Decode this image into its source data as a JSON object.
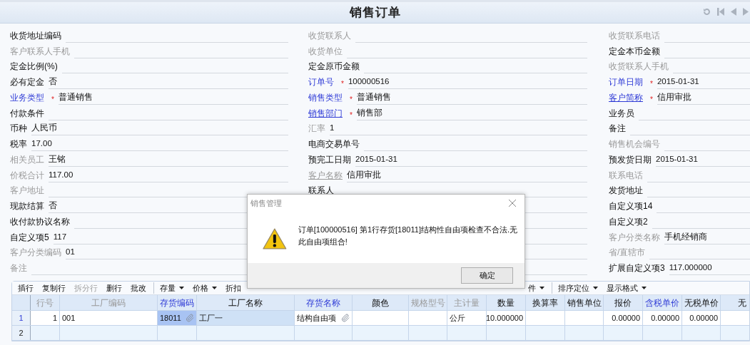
{
  "header": {
    "title": "销售订单"
  },
  "form": {
    "columns": [
      {
        "fields": [
          {
            "label": "收货地址编码",
            "kind": "normal"
          },
          {
            "label": "客户联系人手机",
            "kind": "muted"
          },
          {
            "label": "定金比例(%)",
            "kind": "normal"
          },
          {
            "label": "必有定金",
            "kind": "normal",
            "value": "否"
          },
          {
            "label": "业务类型",
            "kind": "blue",
            "marker": "*",
            "value": "普通销售"
          },
          {
            "label": "付款条件",
            "kind": "normal"
          },
          {
            "label": "币种",
            "kind": "normal",
            "value": "人民币"
          },
          {
            "label": "税率",
            "kind": "normal",
            "value": "17.00"
          },
          {
            "label": "相关员工",
            "kind": "muted",
            "value": "王铭"
          },
          {
            "label": "价税合计",
            "kind": "muted",
            "value": "117.00"
          },
          {
            "label": "客户地址",
            "kind": "muted"
          },
          {
            "label": "现款结算",
            "kind": "normal",
            "value": "否"
          },
          {
            "label": "收付款协议名称",
            "kind": "normal"
          },
          {
            "label": "自定义项5",
            "kind": "normal",
            "value": "117"
          },
          {
            "label": "客户分类编码",
            "kind": "muted",
            "value": "01"
          },
          {
            "label": "备注",
            "kind": "muted"
          }
        ]
      },
      {
        "fields": [
          {
            "label": "收货联系人",
            "kind": "muted"
          },
          {
            "label": "收货单位",
            "kind": "muted"
          },
          {
            "label": "定金原币金额",
            "kind": "normal"
          },
          {
            "label": "订单号",
            "kind": "blue",
            "marker": "*",
            "value": "100000516"
          },
          {
            "label": "销售类型",
            "kind": "blue",
            "marker": "*",
            "value": "普通销售"
          },
          {
            "label": "销售部门",
            "kind": "link",
            "marker": "*",
            "value": "销售部"
          },
          {
            "label": "汇率",
            "kind": "muted",
            "value": "1"
          },
          {
            "label": "电商交易单号",
            "kind": "normal"
          },
          {
            "label": "预完工日期",
            "kind": "normal",
            "value": "2015-01-31"
          },
          {
            "label": "客户名称",
            "kind": "muted_link",
            "value": "信用审批"
          },
          {
            "label": "联系人",
            "kind": "normal"
          }
        ]
      },
      {
        "fields": [
          {
            "label": "收货联系电话",
            "kind": "muted"
          },
          {
            "label": "定金本币金额",
            "kind": "normal"
          },
          {
            "label": "收货联系人手机",
            "kind": "muted"
          },
          {
            "label": "订单日期",
            "kind": "blue",
            "marker": "*",
            "value": "2015-01-31"
          },
          {
            "label": "客户简称",
            "kind": "link",
            "marker": "*",
            "value": "信用审批"
          },
          {
            "label": "业务员",
            "kind": "normal"
          },
          {
            "label": "备注",
            "kind": "normal"
          },
          {
            "label": "销售机会编号",
            "kind": "muted"
          },
          {
            "label": "预发货日期",
            "kind": "normal",
            "value": "2015-01-31"
          },
          {
            "label": "联系电话",
            "kind": "muted"
          },
          {
            "label": "发货地址",
            "kind": "normal"
          },
          {
            "label": "自定义项14",
            "kind": "normal"
          },
          {
            "label": "自定义项2",
            "kind": "normal"
          },
          {
            "label": "客户分类名称",
            "kind": "muted",
            "value": "手机经销商"
          },
          {
            "label": "省/直辖市",
            "kind": "muted"
          },
          {
            "label": "扩展自定义项3",
            "kind": "normal",
            "value": "117.000000"
          }
        ]
      }
    ]
  },
  "grid": {
    "toolbar": [
      {
        "label": "插行",
        "disabled": false,
        "dropdown": false,
        "separator_before": false
      },
      {
        "label": "复制行",
        "disabled": false,
        "dropdown": false,
        "separator_before": false
      },
      {
        "label": "拆分行",
        "disabled": true,
        "dropdown": false,
        "separator_before": false
      },
      {
        "label": "删行",
        "disabled": false,
        "dropdown": false,
        "separator_before": false
      },
      {
        "label": "批改",
        "disabled": false,
        "dropdown": false,
        "separator_before": false
      },
      {
        "label": "存量",
        "disabled": false,
        "dropdown": true,
        "separator_before": true
      },
      {
        "label": "价格",
        "disabled": false,
        "dropdown": true,
        "separator_before": false
      },
      {
        "label": "折扣",
        "disabled": false,
        "dropdown": false,
        "separator_before": false
      },
      {
        "label": "件",
        "disabled": false,
        "dropdown": true,
        "separator_before": false
      },
      {
        "label": "排序定位",
        "disabled": false,
        "dropdown": true,
        "separator_before": true
      },
      {
        "label": "显示格式",
        "disabled": false,
        "dropdown": true,
        "separator_before": false
      }
    ],
    "columns": [
      {
        "label": "行号",
        "kind": "muted"
      },
      {
        "label": "工厂编码",
        "kind": "muted"
      },
      {
        "label": "存货编码",
        "kind": "blue"
      },
      {
        "label": "工厂名称",
        "kind": "normal"
      },
      {
        "label": "存货名称",
        "kind": "blue"
      },
      {
        "label": "颜色",
        "kind": "normal"
      },
      {
        "label": "规格型号",
        "kind": "muted"
      },
      {
        "label": "主计量",
        "kind": "muted"
      },
      {
        "label": "数量",
        "kind": "normal"
      },
      {
        "label": "换算率",
        "kind": "normal"
      },
      {
        "label": "销售单位",
        "kind": "normal"
      },
      {
        "label": "报价",
        "kind": "normal"
      },
      {
        "label": "含税单价",
        "kind": "blue"
      },
      {
        "label": "无税单价",
        "kind": "normal"
      },
      {
        "label": "无",
        "kind": "normal"
      }
    ],
    "rows": [
      {
        "number": "1",
        "selected": true,
        "cells": [
          {
            "text": "1",
            "selected": false,
            "highlighted": false,
            "attachment": false
          },
          {
            "text": "001",
            "selected": false,
            "highlighted": false,
            "attachment": false
          },
          {
            "text": "18011",
            "selected": true,
            "highlighted": false,
            "attachment": true
          },
          {
            "text": "工厂一",
            "selected": false,
            "highlighted": true,
            "attachment": false
          },
          {
            "text": "结构自由项",
            "selected": false,
            "highlighted": false,
            "attachment": true
          },
          {
            "selected": false,
            "highlighted": false,
            "attachment": false
          },
          {
            "selected": false,
            "highlighted": false,
            "attachment": false
          },
          {
            "text": "公斤",
            "selected": false,
            "highlighted": false,
            "attachment": false
          },
          {
            "text": "10.000000",
            "selected": false,
            "highlighted": false,
            "attachment": false
          },
          {
            "selected": false,
            "highlighted": false,
            "attachment": false
          },
          {
            "selected": false,
            "highlighted": false,
            "attachment": false
          },
          {
            "text": "0.00000",
            "selected": false,
            "highlighted": false,
            "attachment": false
          },
          {
            "text": "0.00000",
            "selected": false,
            "highlighted": false,
            "attachment": false
          },
          {
            "text": "0.00000",
            "selected": false,
            "highlighted": false,
            "attachment": false
          },
          {
            "selected": false,
            "highlighted": false,
            "attachment": false
          }
        ]
      },
      {
        "number": "2",
        "selected": false
      }
    ]
  },
  "dialog": {
    "title": "销售管理",
    "message": "订单[100000516] 第1行存货[18011]结构性自由项检查不合法.无此自由项组合!",
    "buttons": [
      "确定"
    ]
  }
}
